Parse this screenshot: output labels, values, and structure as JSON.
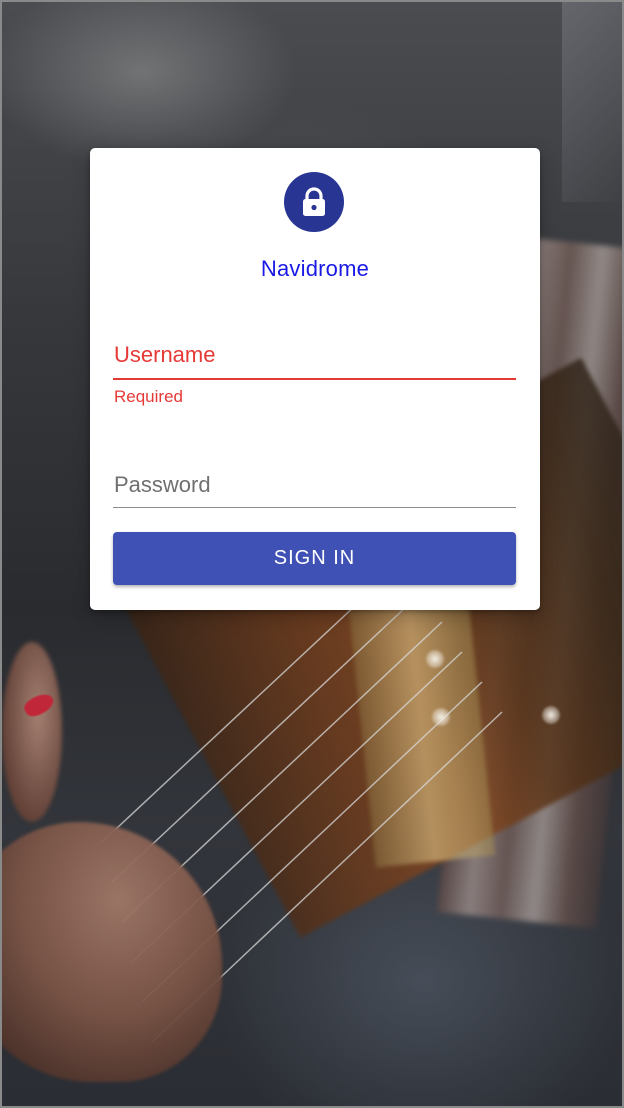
{
  "app": {
    "title": "Navidrome"
  },
  "login": {
    "username": {
      "label": "Username",
      "value": "",
      "helper_text": "Required",
      "state": "error"
    },
    "password": {
      "label": "Password",
      "value": ""
    },
    "submit_label": "SIGN IN"
  },
  "icons": {
    "avatar": "lock-icon"
  },
  "colors": {
    "primary": "#3f51b5",
    "avatar_bg": "#283593",
    "title_text": "#1a1ae6",
    "error": "#e53935",
    "card_bg": "#ffffff"
  }
}
